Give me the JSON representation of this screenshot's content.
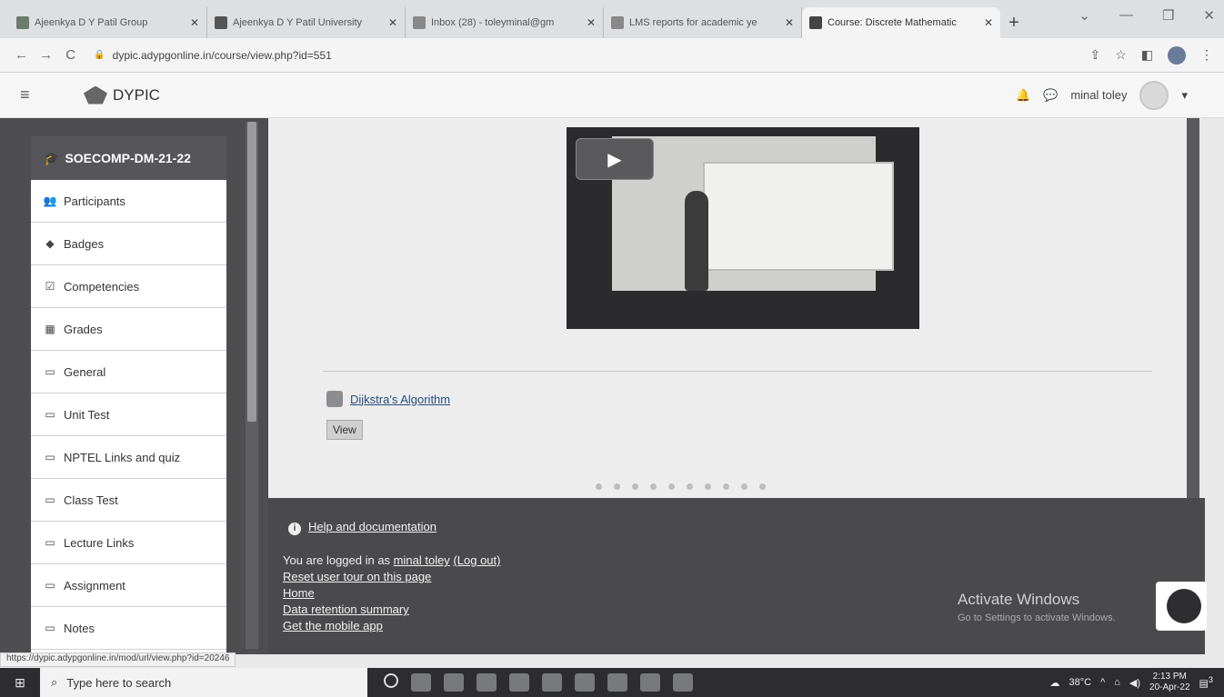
{
  "browser": {
    "tabs": [
      {
        "title": "Ajeenkya D Y Patil Group",
        "active": false,
        "color": "#6b7b6e"
      },
      {
        "title": "Ajeenkya D Y Patil University",
        "active": false,
        "color": "#444"
      },
      {
        "title": "Inbox (28) - toleyminal@gm",
        "active": false,
        "color": "#666"
      },
      {
        "title": "LMS reports for academic ye",
        "active": false,
        "color": "#666"
      },
      {
        "title": "Course: Discrete Mathematic",
        "active": true,
        "color": "#333"
      }
    ],
    "new_tab": "+",
    "url": "dypic.adypgonline.in/course/view.php?id=551",
    "status_url": "https://dypic.adypgonline.in/mod/url/view.php?id=20246"
  },
  "header": {
    "brand": "DYPIC",
    "user_name": "minal toley"
  },
  "sidebar": {
    "course": "SOECOMP-DM-21-22",
    "items": [
      {
        "label": "Participants",
        "icon": "👥"
      },
      {
        "label": "Badges",
        "icon": "◆"
      },
      {
        "label": "Competencies",
        "icon": "☑"
      },
      {
        "label": "Grades",
        "icon": "▦"
      },
      {
        "label": "General",
        "icon": "▭"
      },
      {
        "label": "Unit Test",
        "icon": "▭"
      },
      {
        "label": "NPTEL Links and quiz",
        "icon": "▭"
      },
      {
        "label": "Class Test",
        "icon": "▭"
      },
      {
        "label": "Lecture Links",
        "icon": "▭"
      },
      {
        "label": "Assignment",
        "icon": "▭"
      },
      {
        "label": "Notes",
        "icon": "▭"
      }
    ]
  },
  "main": {
    "resource_title": "Dijkstra's Algorithm",
    "view_button": "View"
  },
  "footer": {
    "help": "Help and documentation",
    "logged_in_prefix": "You are logged in as ",
    "logged_in_user": "minal toley",
    "logout": "(Log out)",
    "reset_tour": "Reset user tour on this page",
    "home": "Home",
    "data_retention": "Data retention summary",
    "mobile_app": "Get the mobile app"
  },
  "watermark": {
    "line1": "Activate Windows",
    "line2": "Go to Settings to activate Windows."
  },
  "taskbar": {
    "search_placeholder": "Type here to search",
    "temperature": "38°C",
    "time": "2:13 PM",
    "date": "20-Apr-22",
    "notifications": "3"
  }
}
